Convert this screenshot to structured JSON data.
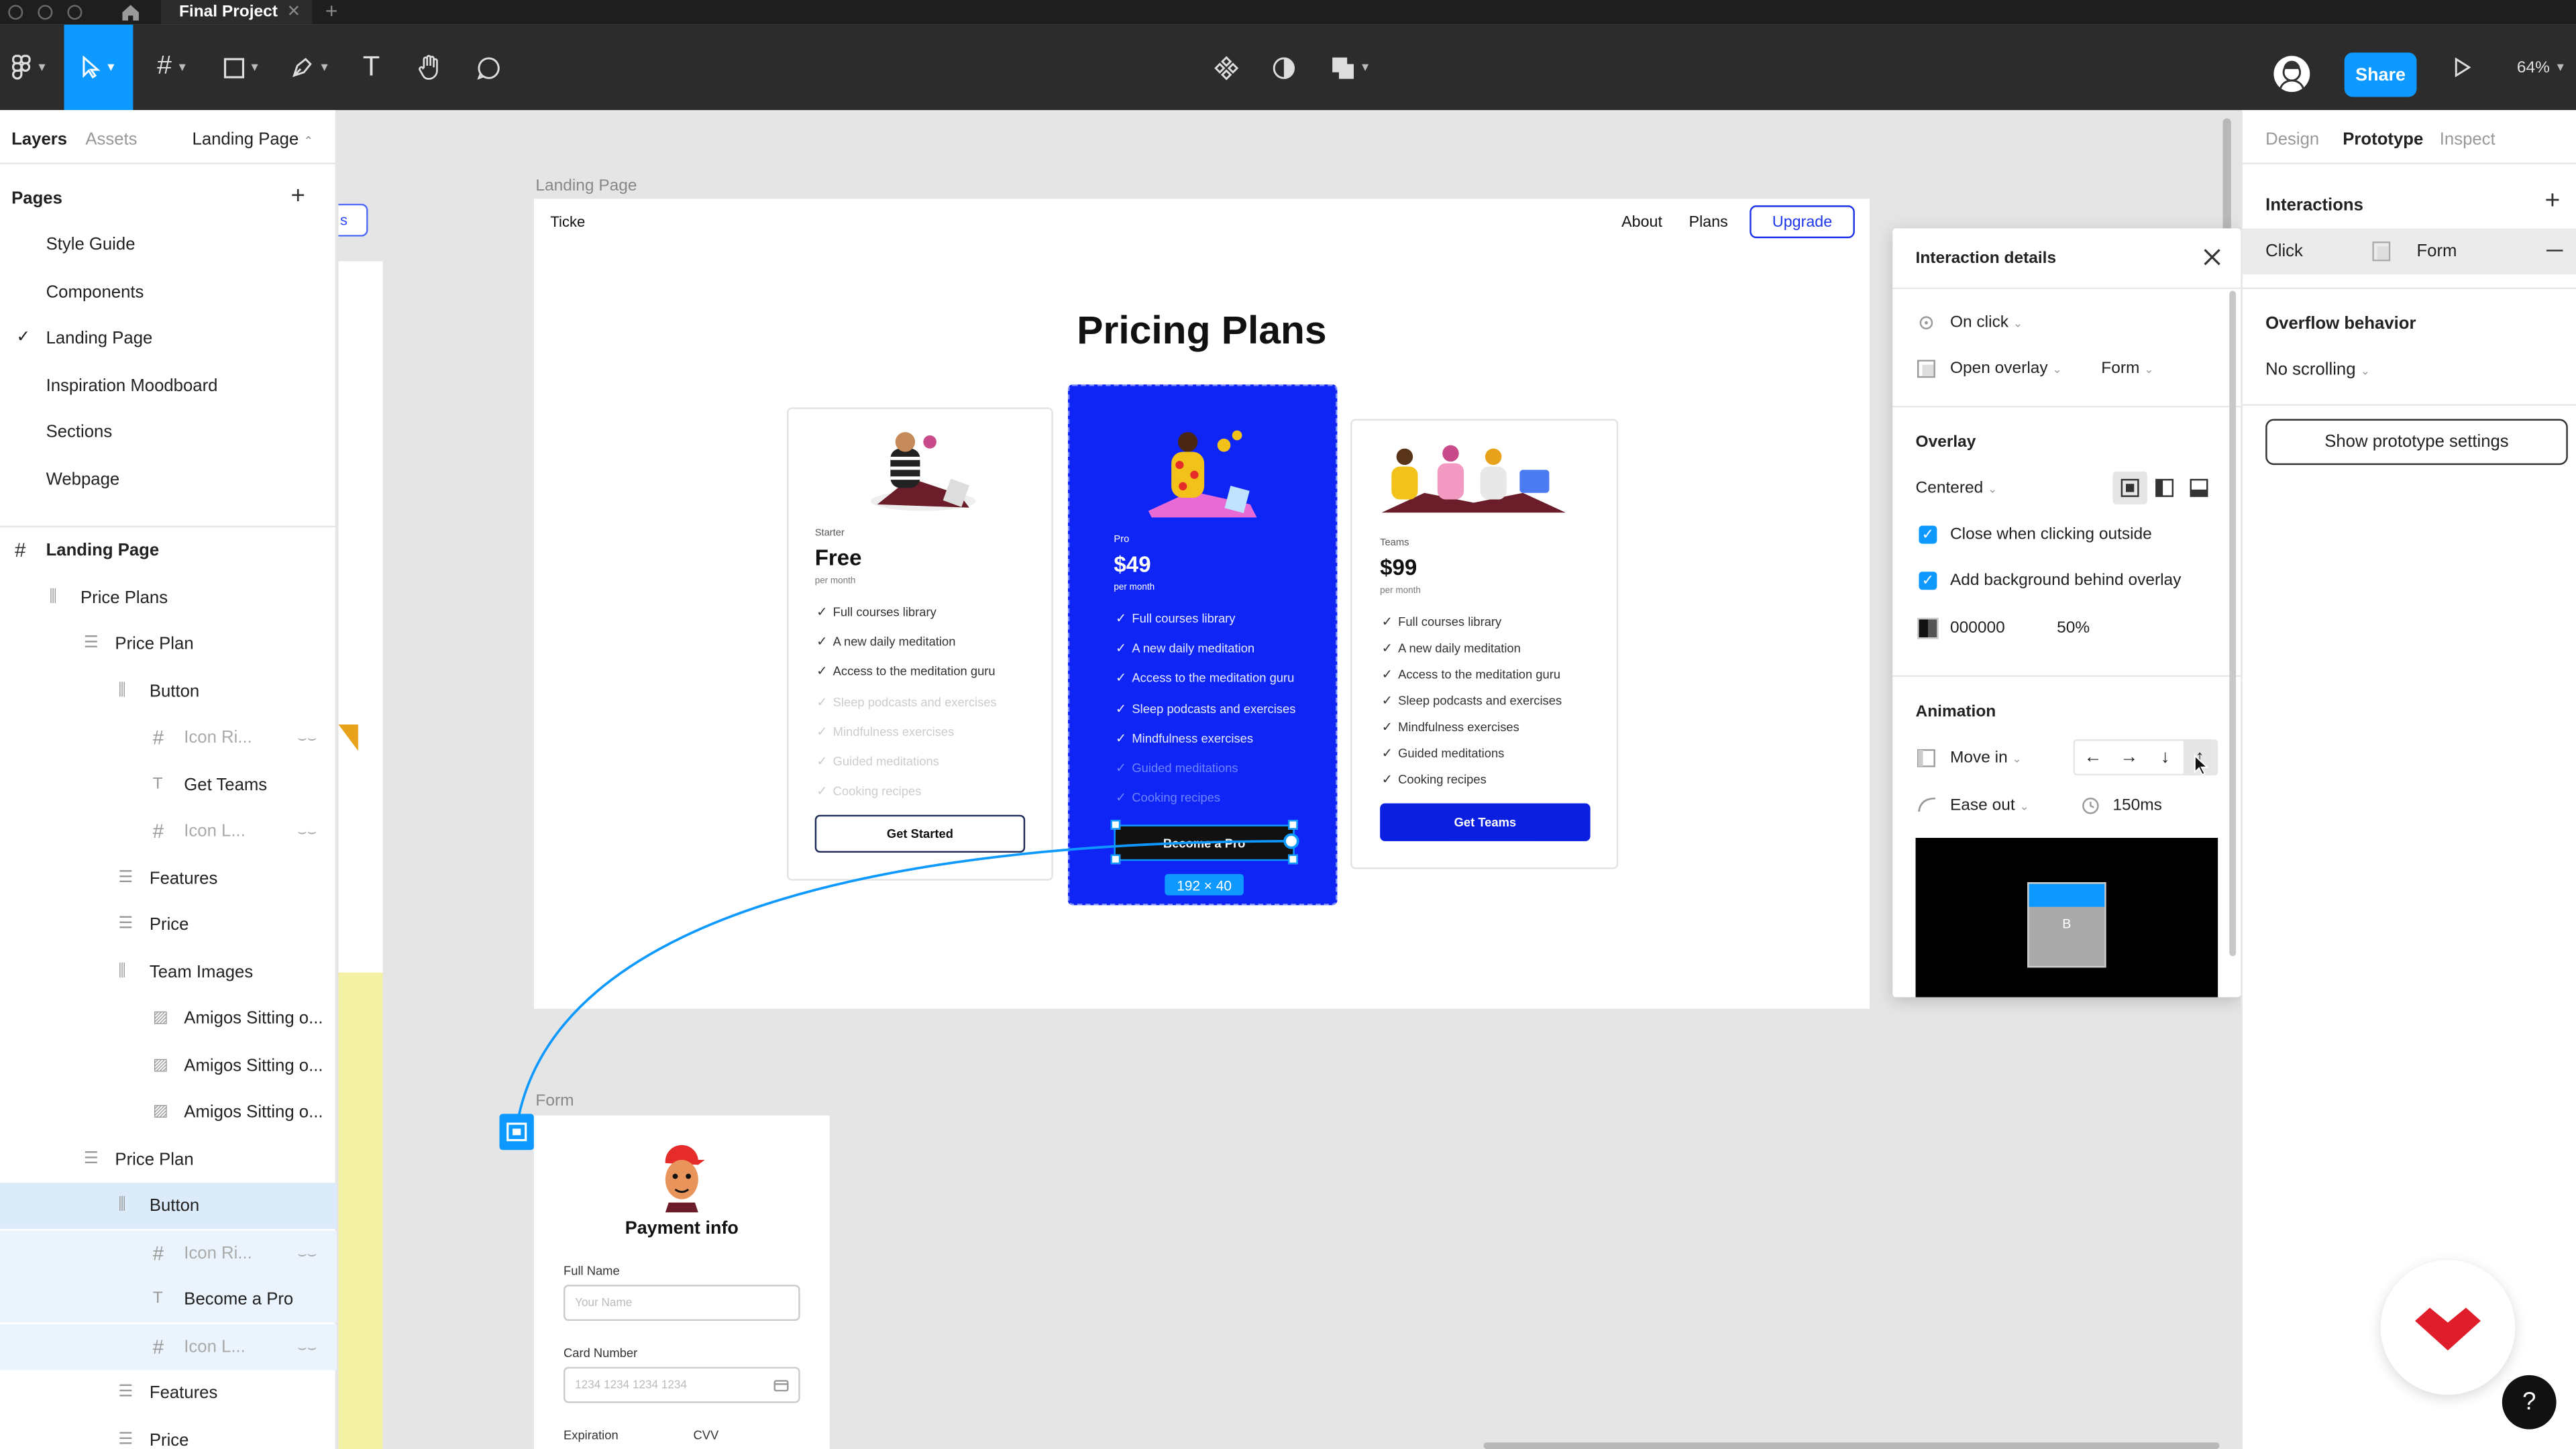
{
  "titlebar": {
    "tab_title": "Final Project",
    "close_glyph": "✕",
    "new_tab_glyph": "+"
  },
  "toolbar": {
    "share_label": "Share",
    "zoom": "64%"
  },
  "left_panel": {
    "tabs": {
      "layers": "Layers",
      "assets": "Assets",
      "page_selector": "Landing Page"
    },
    "pages_header": "Pages",
    "pages": [
      "Style Guide",
      "Components",
      "Landing Page",
      "Inspiration Moodboard",
      "Sections",
      "Webpage"
    ],
    "current_page": "Landing Page",
    "layers": [
      {
        "label": "Landing Page",
        "indent": 0,
        "icon": "frame-icon",
        "state": "bold"
      },
      {
        "label": "Price Plans",
        "indent": 1,
        "icon": "autolayout-h-icon",
        "state": ""
      },
      {
        "label": "Price Plan",
        "indent": 2,
        "icon": "autolayout-v-icon",
        "state": ""
      },
      {
        "label": "Button",
        "indent": 3,
        "icon": "autolayout-h-icon",
        "state": ""
      },
      {
        "label": "Icon Ri...",
        "indent": 4,
        "icon": "frame-icon",
        "state": "hidden"
      },
      {
        "label": "Get Teams",
        "indent": 4,
        "icon": "text-icon",
        "state": ""
      },
      {
        "label": "Icon L...",
        "indent": 4,
        "icon": "frame-icon",
        "state": "hidden"
      },
      {
        "label": "Features",
        "indent": 3,
        "icon": "autolayout-v-icon",
        "state": ""
      },
      {
        "label": "Price",
        "indent": 3,
        "icon": "autolayout-v-icon",
        "state": ""
      },
      {
        "label": "Team Images",
        "indent": 3,
        "icon": "autolayout-h-icon",
        "state": ""
      },
      {
        "label": "Amigos Sitting o...",
        "indent": 4,
        "icon": "image-icon",
        "state": ""
      },
      {
        "label": "Amigos Sitting o...",
        "indent": 4,
        "icon": "image-icon",
        "state": ""
      },
      {
        "label": "Amigos Sitting o...",
        "indent": 4,
        "icon": "image-icon",
        "state": ""
      },
      {
        "label": "Price Plan",
        "indent": 2,
        "icon": "autolayout-v-icon",
        "state": ""
      },
      {
        "label": "Button",
        "indent": 3,
        "icon": "autolayout-h-icon",
        "state": "selected"
      },
      {
        "label": "Icon Ri...",
        "indent": 4,
        "icon": "frame-icon",
        "state": "hidden-sub"
      },
      {
        "label": "Become a Pro",
        "indent": 4,
        "icon": "text-icon",
        "state": "sub"
      },
      {
        "label": "Icon L...",
        "indent": 4,
        "icon": "frame-icon",
        "state": "hidden-sub"
      },
      {
        "label": "Features",
        "indent": 3,
        "icon": "autolayout-v-icon",
        "state": ""
      },
      {
        "label": "Price",
        "indent": 3,
        "icon": "autolayout-v-icon",
        "state": ""
      }
    ]
  },
  "canvas": {
    "landing_frame_label": "Landing Page",
    "form_frame_label": "Form",
    "nav": {
      "logo": "Ticke",
      "about": "About",
      "plans": "Plans",
      "upgrade": "Upgrade",
      "offscreen_button": "s"
    },
    "heading": "Pricing Plans",
    "size_badge": "192 × 40",
    "plans": [
      {
        "id": "starter",
        "tier": "Starter",
        "price": "Free",
        "per": "per month",
        "features": [
          {
            "text": "Full courses library",
            "on": true
          },
          {
            "text": "A new daily meditation",
            "on": true
          },
          {
            "text": "Access to the meditation guru",
            "on": true
          },
          {
            "text": "Sleep podcasts and exercises",
            "on": false
          },
          {
            "text": "Mindfulness exercises",
            "on": false
          },
          {
            "text": "Guided meditations",
            "on": false
          },
          {
            "text": "Cooking recipes",
            "on": false
          }
        ],
        "button": "Get Started"
      },
      {
        "id": "pro",
        "tier": "Pro",
        "price": "$49",
        "per": "per month",
        "features": [
          {
            "text": "Full courses library",
            "on": true
          },
          {
            "text": "A new daily meditation",
            "on": true
          },
          {
            "text": "Access to the meditation guru",
            "on": true
          },
          {
            "text": "Sleep podcasts and exercises",
            "on": true
          },
          {
            "text": "Mindfulness exercises",
            "on": true
          },
          {
            "text": "Guided meditations",
            "on": false
          },
          {
            "text": "Cooking recipes",
            "on": false
          }
        ],
        "button": "Become a Pro"
      },
      {
        "id": "teams",
        "tier": "Teams",
        "price": "$99",
        "per": "per month",
        "features": [
          {
            "text": "Full courses library",
            "on": true
          },
          {
            "text": "A new daily meditation",
            "on": true
          },
          {
            "text": "Access to the meditation guru",
            "on": true
          },
          {
            "text": "Sleep podcasts and exercises",
            "on": true
          },
          {
            "text": "Mindfulness exercises",
            "on": true
          },
          {
            "text": "Guided meditations",
            "on": true
          },
          {
            "text": "Cooking recipes",
            "on": true
          }
        ],
        "button": "Get Teams"
      }
    ],
    "form": {
      "title": "Payment info",
      "full_name_label": "Full Name",
      "full_name_placeholder": "Your Name",
      "card_label": "Card Number",
      "card_placeholder": "1234  1234  1234  1234",
      "expiration_label": "Expiration",
      "cvv_label": "CVV"
    }
  },
  "interaction_panel": {
    "title": "Interaction details",
    "trigger": "On click",
    "action": "Open overlay",
    "destination": "Form",
    "overlay_header": "Overlay",
    "position": "Centered",
    "close_outside_label": "Close when clicking outside",
    "add_background_label": "Add background behind overlay",
    "bg_color": "000000",
    "bg_opacity": "50%",
    "animation_header": "Animation",
    "animation": "Move in",
    "easing": "Ease out",
    "duration": "150ms",
    "preview_label": "B",
    "direction_arrows": [
      "←",
      "→",
      "↓",
      "↑"
    ]
  },
  "right_panel": {
    "tabs": {
      "design": "Design",
      "prototype": "Prototype",
      "inspect": "Inspect"
    },
    "interactions_header": "Interactions",
    "interaction_trigger": "Click",
    "interaction_target": "Form",
    "overflow_header": "Overflow behavior",
    "overflow_value": "No scrolling",
    "settings_button": "Show prototype settings"
  },
  "help_label": "?",
  "colors": {
    "accent": "#0d99ff",
    "pro_blue": "#0f25f5",
    "teams_btn": "#0a1fe0",
    "brand_red": "#e01e2b"
  }
}
